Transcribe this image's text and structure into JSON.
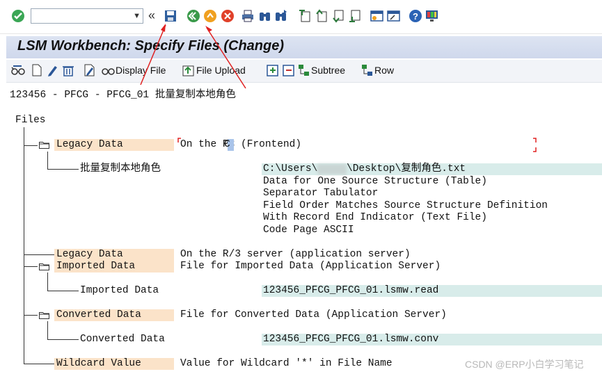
{
  "toolbar": {
    "command_field_value": "",
    "collapse_glyph": "«",
    "icons": [
      "enter-icon",
      "save-icon",
      "back-icon",
      "exit-icon",
      "cancel-icon",
      "print-icon",
      "find-icon",
      "find-next-icon",
      "first-page-icon",
      "previous-page-icon",
      "next-page-icon",
      "last-page-icon",
      "create-session-icon",
      "shortcut-icon",
      "help-icon",
      "customize-layout-icon"
    ]
  },
  "title": "LSM Workbench: Specify Files (Change)",
  "app_toolbar": {
    "display_file": "Display File",
    "file_upload": "File Upload",
    "subtree": "Subtree",
    "row": "Row"
  },
  "header_line": "123456 - PFCG - PFCG_01 批量复制本地角色",
  "tree": {
    "files_label": "Files",
    "legacy_pc_label": "Legacy Data",
    "legacy_pc_desc": "On the PC (Frontend)",
    "local_file_name": "批量复制本地角色",
    "local_file_path": "C:\\Users\\",
    "local_file_path_rest": "\\Desktop\\复制角色.txt",
    "file_props": [
      "Data for One Source Structure (Table)",
      "Separator Tabulator",
      "Field Order Matches Source Structure Definition",
      "With Record End Indicator (Text File)",
      "Code Page ASCII"
    ],
    "legacy_server_label": "Legacy Data",
    "legacy_server_desc": "On the R/3 server (application server)",
    "imported_label": "Imported Data",
    "imported_desc": "File for Imported Data (Application Server)",
    "imported_child_label": "Imported Data",
    "imported_child_value": "123456_PFCG_PFCG_01.lsmw.read",
    "converted_label": "Converted Data",
    "converted_desc": "File for Converted Data (Application Server)",
    "converted_child_label": "Converted Data",
    "converted_child_value": "123456_PFCG_PFCG_01.lsmw.conv",
    "wildcard_label": "Wildcard Value",
    "wildcard_desc": "Value for Wildcard '*' in File Name"
  },
  "watermark": "CSDN @ERP小白学习笔记",
  "colors": {
    "label_bg": "#fbe3c9",
    "value_bg": "#d8ecea",
    "title_bg": "#d5ddee",
    "annotation": "#e02020"
  }
}
